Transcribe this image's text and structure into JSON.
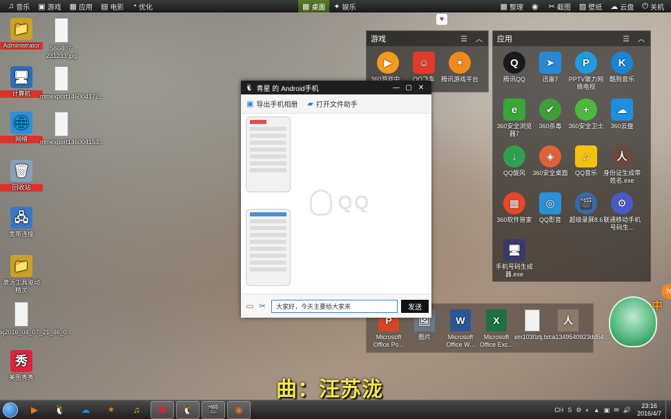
{
  "topbar": {
    "left": [
      {
        "icon": "music-note-icon",
        "label": "音乐"
      },
      {
        "icon": "gamepad-icon",
        "label": "游戏"
      },
      {
        "icon": "apps-icon",
        "label": "应用"
      },
      {
        "icon": "film-icon",
        "label": "电影"
      },
      {
        "icon": "optimize-icon",
        "label": "优化"
      }
    ],
    "center": [
      {
        "icon": "desktop-icon",
        "label": "桌面"
      },
      {
        "icon": "star-icon",
        "label": "娱乐"
      }
    ],
    "right": [
      {
        "icon": "grid-icon",
        "label": "整理"
      },
      {
        "icon": "eye-icon",
        "label": ""
      },
      {
        "icon": "screenshot-icon",
        "label": "截图"
      },
      {
        "icon": "wallpaper-icon",
        "label": "壁纸"
      },
      {
        "icon": "cloud-icon",
        "label": "云盘"
      },
      {
        "icon": "power-icon",
        "label": "关机"
      }
    ]
  },
  "desktop_icons": [
    {
      "label": "Administrator",
      "glyph": "📁",
      "color": "#c9a227",
      "selected": true
    },
    {
      "label": "S60407-231233.jpg",
      "glyph": "",
      "color": "#f2f2f2"
    },
    {
      "label": "计算机",
      "glyph": "🖥",
      "color": "#2c6fb6",
      "selected": true
    },
    {
      "label": "mmexport146004172...",
      "glyph": "",
      "color": "#f2f2f2"
    },
    {
      "label": "网络",
      "glyph": "🌐",
      "color": "#2f8fd8",
      "selected": true
    },
    {
      "label": "mmexport146004153...",
      "glyph": "",
      "color": "#f2f2f2"
    },
    {
      "label": "回收站",
      "glyph": "🗑",
      "color": "#8aa0b8",
      "selected": true
    },
    {
      "label": "宽带连接",
      "glyph": "🖧",
      "color": "#3a78c2"
    },
    {
      "label": "激活工具驱动精灵",
      "glyph": "📁",
      "color": "#c9a227"
    },
    {
      "label": "xj2016_04_07_21_46_0...",
      "glyph": "",
      "color": "#7a8a6a"
    },
    {
      "label": "美图秀秀",
      "glyph": "秀",
      "color": "#d8243c"
    }
  ],
  "fence_games": {
    "title": "游戏",
    "apps": [
      {
        "label": "360游戏中...",
        "glyph": "▶",
        "color": "#f39a1f"
      },
      {
        "label": "QQ飞车",
        "glyph": "☺",
        "color": "#e23b2b"
      },
      {
        "label": "腾讯游戏平台",
        "glyph": "✶",
        "color": "#f08a1c"
      }
    ]
  },
  "fence_apps": {
    "title": "应用",
    "apps": [
      {
        "label": "腾讯QQ",
        "glyph": "Q",
        "color": "#1a1a1a"
      },
      {
        "label": "迅雷7",
        "glyph": "➤",
        "color": "#2a88d8"
      },
      {
        "label": "PPTV聚力网络电视",
        "glyph": "P",
        "color": "#1f9be0"
      },
      {
        "label": "酷狗音乐",
        "glyph": "K",
        "color": "#1985d9"
      },
      {
        "label": "360安全浏览器7",
        "glyph": "e",
        "color": "#3aa63a"
      },
      {
        "label": "360杀毒",
        "glyph": "✔",
        "color": "#3f9e3a"
      },
      {
        "label": "360安全卫士",
        "glyph": "+",
        "color": "#4db83d"
      },
      {
        "label": "360云盘",
        "glyph": "☁",
        "color": "#1c8fe0"
      },
      {
        "label": "QQ旋风",
        "glyph": "↓",
        "color": "#2fa050"
      },
      {
        "label": "360安全桌面",
        "glyph": "◈",
        "color": "#e0603a"
      },
      {
        "label": "QQ音乐",
        "glyph": "♫",
        "color": "#f4c20d"
      },
      {
        "label": "身份证生成带姓名.exe",
        "glyph": "人",
        "color": "#6a4a3a"
      },
      {
        "label": "360软件管家",
        "glyph": "▦",
        "color": "#e8472a"
      },
      {
        "label": "QQ影音",
        "glyph": "◎",
        "color": "#2a90d8"
      },
      {
        "label": "超级录屏8.6",
        "glyph": "🎬",
        "color": "#3a6aa8"
      },
      {
        "label": "联通移动手机号码生...",
        "glyph": "⚙",
        "color": "#4a5ac8"
      },
      {
        "label": "手机号码生成器.exe",
        "glyph": "🖥",
        "color": "#3a3a6a"
      }
    ]
  },
  "qq_window": {
    "title": "青星 的 Android手机",
    "tools": [
      {
        "icon": "export-album-icon",
        "label": "导出手机相册"
      },
      {
        "icon": "folder-icon",
        "label": "打开文件助手"
      }
    ],
    "watermark": "QQ",
    "input_value": "大家好，今天主要给大家来",
    "send_label": "发送"
  },
  "bottom_files": [
    {
      "label": "Microsoft Office Po...",
      "glyph": "P",
      "color": "#d24726"
    },
    {
      "label": "图片",
      "glyph": "🖼",
      "color": "#6a7a8a"
    },
    {
      "label": "Microsoft Office W...",
      "glyph": "W",
      "color": "#2b5797"
    },
    {
      "label": "Microsoft Office Exc...",
      "glyph": "X",
      "color": "#1e7145"
    },
    {
      "label": "xm1030zlj.txt",
      "glyph": "",
      "color": "#f2f2f2"
    },
    {
      "label": "ca1349540923dd54...",
      "glyph": "人",
      "color": "#8a7a6a"
    }
  ],
  "subtitle": "曲：汪苏泷",
  "taskbar": {
    "buttons": [
      {
        "icon": "media-player-icon",
        "glyph": "▶",
        "color": "#e07a20",
        "active": false
      },
      {
        "icon": "qq-icon",
        "glyph": "🐧",
        "color": "#ffd24a",
        "active": false
      },
      {
        "icon": "cloud-app-icon",
        "glyph": "☁",
        "color": "#1c8fe0",
        "active": false
      },
      {
        "icon": "game-platform-icon",
        "glyph": "✶",
        "color": "#f08a1c",
        "active": false
      },
      {
        "icon": "qq-music-icon",
        "glyph": "♫",
        "color": "#f4c20d",
        "active": false
      },
      {
        "icon": "meitu-icon",
        "glyph": "秀",
        "color": "#d8243c",
        "active": true
      },
      {
        "icon": "qq-chat-icon",
        "glyph": "🐧",
        "color": "#ffd24a",
        "active": true
      },
      {
        "icon": "clapper-icon",
        "glyph": "🎬",
        "color": "#6a8ab8",
        "active": true
      },
      {
        "icon": "recorder-icon",
        "glyph": "◉",
        "color": "#e8702a",
        "active": true
      }
    ],
    "tray": [
      "CH",
      "S",
      "⚙",
      "◐",
      "▲",
      "▣",
      "✉",
      "🔊"
    ],
    "time": "23:16",
    "date": "2016/4/7"
  },
  "widget": {
    "badge": "76",
    "char": "中"
  }
}
